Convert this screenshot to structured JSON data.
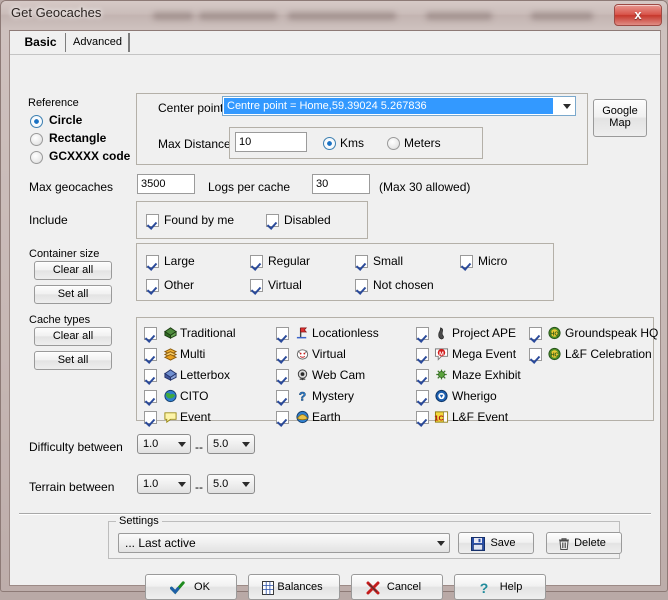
{
  "window": {
    "title": "Get Geocaches",
    "close_label": "x"
  },
  "tabs": [
    {
      "label": "Basic",
      "active": true
    },
    {
      "label": "Advanced",
      "active": false
    }
  ],
  "reference": {
    "legend": "Reference",
    "options": [
      {
        "label": "Circle",
        "selected": true
      },
      {
        "label": "Rectangle",
        "selected": false
      },
      {
        "label": "GCXXXX code",
        "selected": false
      }
    ]
  },
  "center": {
    "center_point_label": "Center point",
    "center_point_value": "Centre point = Home,59.39024 5.267836",
    "max_distance_label": "Max Distance",
    "max_distance_value": "10",
    "units": [
      {
        "label": "Kms",
        "selected": true
      },
      {
        "label": "Meters",
        "selected": false
      }
    ],
    "google_map_line1": "Google",
    "google_map_line2": "Map"
  },
  "limits": {
    "max_geocaches_label": "Max geocaches",
    "max_geocaches_value": "3500",
    "logs_per_cache_label": "Logs per cache",
    "logs_per_cache_value": "30",
    "logs_hint": "(Max 30 allowed)"
  },
  "include": {
    "legend": "Include",
    "items": [
      {
        "label": "Found by me",
        "checked": true
      },
      {
        "label": "Disabled",
        "checked": true
      }
    ]
  },
  "container_size": {
    "legend": "Container size",
    "clear_all": "Clear all",
    "set_all": "Set all",
    "items": [
      {
        "label": "Large",
        "checked": true
      },
      {
        "label": "Regular",
        "checked": true
      },
      {
        "label": "Small",
        "checked": true
      },
      {
        "label": "Micro",
        "checked": true
      },
      {
        "label": "Other",
        "checked": true
      },
      {
        "label": "Virtual",
        "checked": true
      },
      {
        "label": "Not chosen",
        "checked": true
      }
    ]
  },
  "cache_types": {
    "legend": "Cache types",
    "clear_all": "Clear all",
    "set_all": "Set all",
    "items": [
      {
        "label": "Traditional",
        "checked": true,
        "icon": "traditional-cache-icon"
      },
      {
        "label": "Multi",
        "checked": true,
        "icon": "multi-cache-icon"
      },
      {
        "label": "Letterbox",
        "checked": true,
        "icon": "letterbox-cache-icon"
      },
      {
        "label": "CITO",
        "checked": true,
        "icon": "cito-cache-icon"
      },
      {
        "label": "Event",
        "checked": true,
        "icon": "event-cache-icon"
      },
      {
        "label": "Locationless",
        "checked": true,
        "icon": "locationless-cache-icon"
      },
      {
        "label": "Virtual",
        "checked": true,
        "icon": "virtual-cache-icon"
      },
      {
        "label": "Web Cam",
        "checked": true,
        "icon": "webcam-cache-icon"
      },
      {
        "label": "Mystery",
        "checked": true,
        "icon": "mystery-cache-icon"
      },
      {
        "label": "Earth",
        "checked": true,
        "icon": "earth-cache-icon"
      },
      {
        "label": "Project APE",
        "checked": true,
        "icon": "project-ape-cache-icon"
      },
      {
        "label": "Mega Event",
        "checked": true,
        "icon": "mega-event-cache-icon"
      },
      {
        "label": "Maze Exhibit",
        "checked": true,
        "icon": "maze-exhibit-cache-icon"
      },
      {
        "label": "Wherigo",
        "checked": true,
        "icon": "wherigo-cache-icon"
      },
      {
        "label": "L&F Event",
        "checked": true,
        "icon": "lf-event-cache-icon"
      },
      {
        "label": "Groundspeak HQ",
        "checked": true,
        "icon": "groundspeak-hq-cache-icon"
      },
      {
        "label": "L&F Celebration",
        "checked": true,
        "icon": "lf-celebration-cache-icon"
      }
    ]
  },
  "difficulty": {
    "label": "Difficulty between",
    "from": "1.0",
    "separator": "--",
    "to": "5.0"
  },
  "terrain": {
    "label": "Terrain between",
    "from": "1.0",
    "separator": "--",
    "to": "5.0"
  },
  "settings": {
    "legend": "Settings",
    "preset_value": "... Last active",
    "save_label": "Save",
    "delete_label": "Delete"
  },
  "footer": {
    "ok_label": "OK",
    "balances_label": "Balances",
    "cancel_label": "Cancel",
    "help_label": "Help"
  }
}
